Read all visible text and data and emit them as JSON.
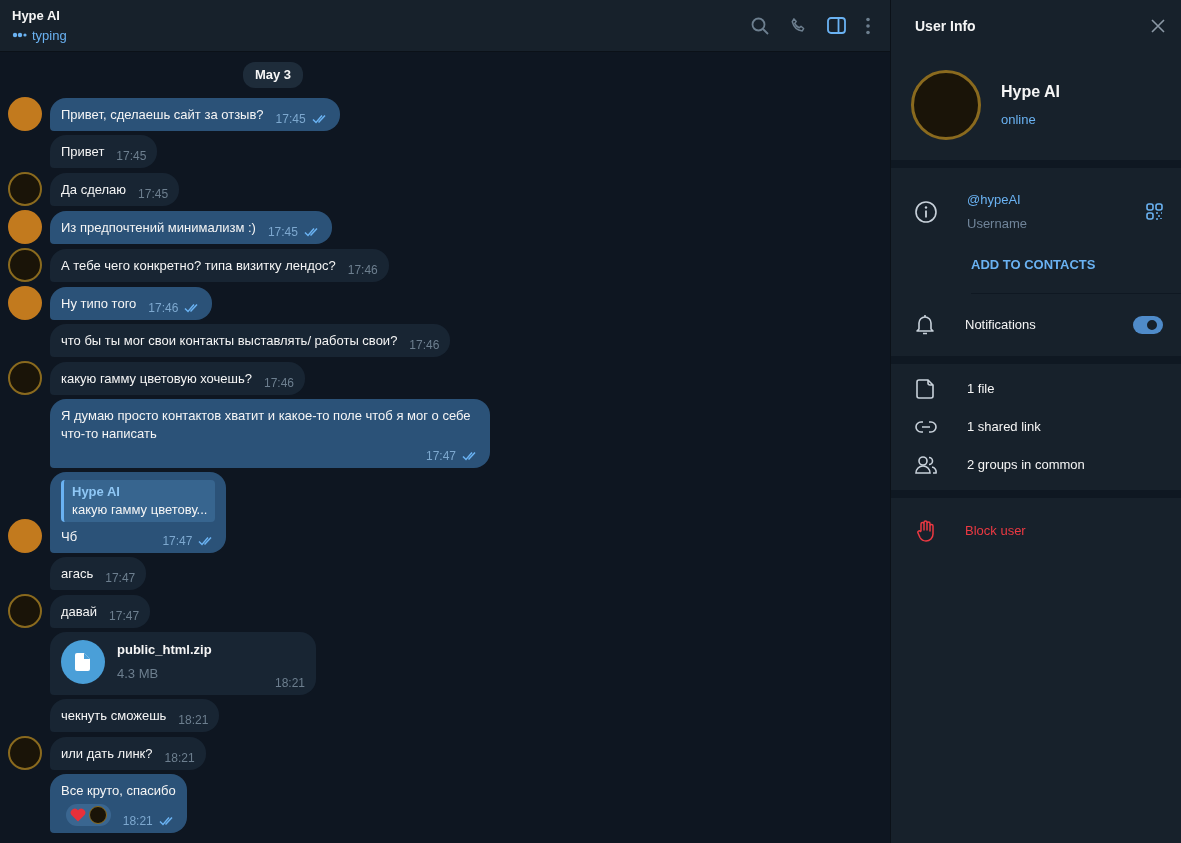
{
  "header": {
    "title": "Hype AI",
    "status": "typing"
  },
  "date_separator": "May 3",
  "messages": [
    {
      "kind": "text",
      "outgoing": true,
      "show_avatar": true,
      "read": true,
      "text": "Привет, сделаешь сайт за отзыв?",
      "time": "17:45"
    },
    {
      "kind": "text",
      "outgoing": false,
      "show_avatar": false,
      "text": "Привет",
      "time": "17:45"
    },
    {
      "kind": "text",
      "outgoing": false,
      "show_avatar": true,
      "text": "Да сделаю",
      "time": "17:45"
    },
    {
      "kind": "text",
      "outgoing": true,
      "show_avatar": true,
      "read": true,
      "text": "Из предпочтений минимализм :)",
      "time": "17:45"
    },
    {
      "kind": "text",
      "outgoing": false,
      "show_avatar": true,
      "text": "А тебе чего конкретно? типа визитку лендос?",
      "time": "17:46"
    },
    {
      "kind": "text",
      "outgoing": true,
      "show_avatar": true,
      "read": true,
      "text": "Ну типо того",
      "time": "17:46"
    },
    {
      "kind": "text",
      "outgoing": false,
      "show_avatar": false,
      "text": "что бы ты мог свои контакты выставлять/ работы свои?",
      "time": "17:46"
    },
    {
      "kind": "text",
      "outgoing": false,
      "show_avatar": true,
      "text": "какую гамму цветовую хочешь?",
      "time": "17:46"
    },
    {
      "kind": "text",
      "outgoing": true,
      "show_avatar": false,
      "read": true,
      "text": "Я думаю просто контактов хватит и какое-то поле чтоб я мог о себе что-то написать",
      "time": "17:47"
    },
    {
      "kind": "reply",
      "outgoing": true,
      "show_avatar": true,
      "read": true,
      "reply_author": "Hype AI",
      "reply_text": "какую гамму цветову...",
      "text": "Чб",
      "time": "17:47"
    },
    {
      "kind": "text",
      "outgoing": false,
      "show_avatar": false,
      "text": "агась",
      "time": "17:47"
    },
    {
      "kind": "text",
      "outgoing": false,
      "show_avatar": true,
      "text": "давай",
      "time": "17:47"
    },
    {
      "kind": "file",
      "outgoing": false,
      "show_avatar": false,
      "file_name": "public_html.zip",
      "file_size": "4.3 MB",
      "time": "18:21"
    },
    {
      "kind": "text",
      "outgoing": false,
      "show_avatar": false,
      "text": "чекнуть сможешь",
      "time": "18:21"
    },
    {
      "kind": "text",
      "outgoing": false,
      "show_avatar": true,
      "text": "или дать линк?",
      "time": "18:21"
    },
    {
      "kind": "text",
      "outgoing": true,
      "show_avatar": false,
      "read": true,
      "has_reaction": true,
      "text": "Все круто, спасибо",
      "time": "18:21"
    }
  ],
  "user_info": {
    "title": "User Info",
    "name": "Hype AI",
    "status": "online",
    "username": "@hypeAI",
    "username_label": "Username",
    "add_contact": "ADD TO CONTACTS",
    "notifications_label": "Notifications",
    "notifications_on": true,
    "media": [
      {
        "kind": "file",
        "label": "1 file"
      },
      {
        "kind": "link",
        "label": "1 shared link"
      },
      {
        "kind": "groups",
        "label": "2 groups in common"
      }
    ],
    "block_label": "Block user"
  }
}
